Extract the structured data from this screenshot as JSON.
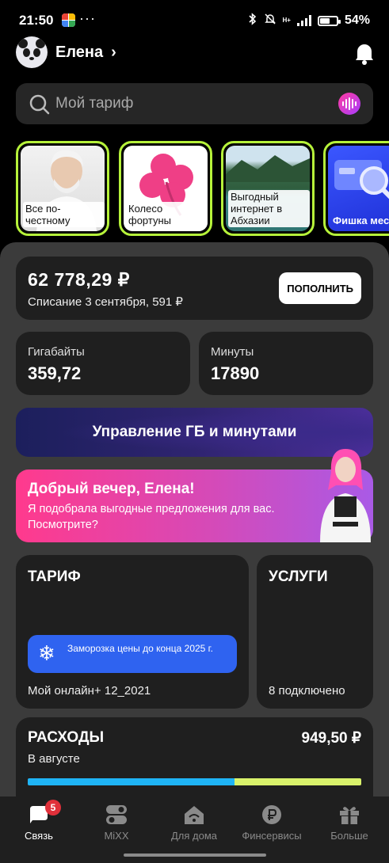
{
  "status_bar": {
    "time": "21:50",
    "dots": "···",
    "network": "H+",
    "battery": "54%",
    "battery_level": 0.54
  },
  "header": {
    "user_name": "Елена",
    "chevron": "›"
  },
  "search": {
    "placeholder": "Мой тариф"
  },
  "stories": [
    {
      "label": "Все по-честному"
    },
    {
      "label": "Колесо фортуны"
    },
    {
      "label": "Выгодный интернет в Абхазии"
    },
    {
      "label": "Фишка месяца"
    }
  ],
  "balance": {
    "amount": "62 778,29 ₽",
    "next_charge": "Списание 3 сентября, 591 ₽",
    "topup_label": "ПОПОЛНИТЬ"
  },
  "gigabytes": {
    "label": "Гигабайты",
    "value": "359,72"
  },
  "minutes": {
    "label": "Минуты",
    "value": "17890"
  },
  "manage_banner": {
    "label": "Управление ГБ и минутами"
  },
  "greeting": {
    "title": "Добрый вечер, Елена!",
    "text": "Я подобрала выгодные предложения для вас. Посмотрите?"
  },
  "tariff": {
    "title": "ТАРИФ",
    "freeze_text": "Заморозка цены до конца 2025 г.",
    "name": "Мой онлайн+ 12_2021"
  },
  "services": {
    "title": "УСЛУГИ",
    "count_text": "8 подключено"
  },
  "expenses": {
    "title": "РАСХОДЫ",
    "amount": "949,50 ₽",
    "period": "В августе",
    "bar_segments": [
      {
        "fraction": 0.62,
        "color": "#1fb4f5"
      },
      {
        "fraction": 0.38,
        "color": "#d9f26b"
      }
    ]
  },
  "nav": {
    "items": [
      {
        "label": "Связь",
        "icon": "chat-icon",
        "badge": "5",
        "active": true
      },
      {
        "label": "MiXX",
        "icon": "toggle-icon",
        "active": false
      },
      {
        "label": "Для дома",
        "icon": "home-wifi-icon",
        "active": false
      },
      {
        "label": "Финсервисы",
        "icon": "ruble-icon",
        "active": false
      },
      {
        "label": "Больше",
        "icon": "gift-icon",
        "active": false
      }
    ]
  },
  "colors": {
    "accent_green": "#b6f23a",
    "card_bg": "#1f1f1f",
    "sheet_bg": "#3b3b3b",
    "freeze_blue": "#2f63f0",
    "badge_red": "#e0303a"
  }
}
